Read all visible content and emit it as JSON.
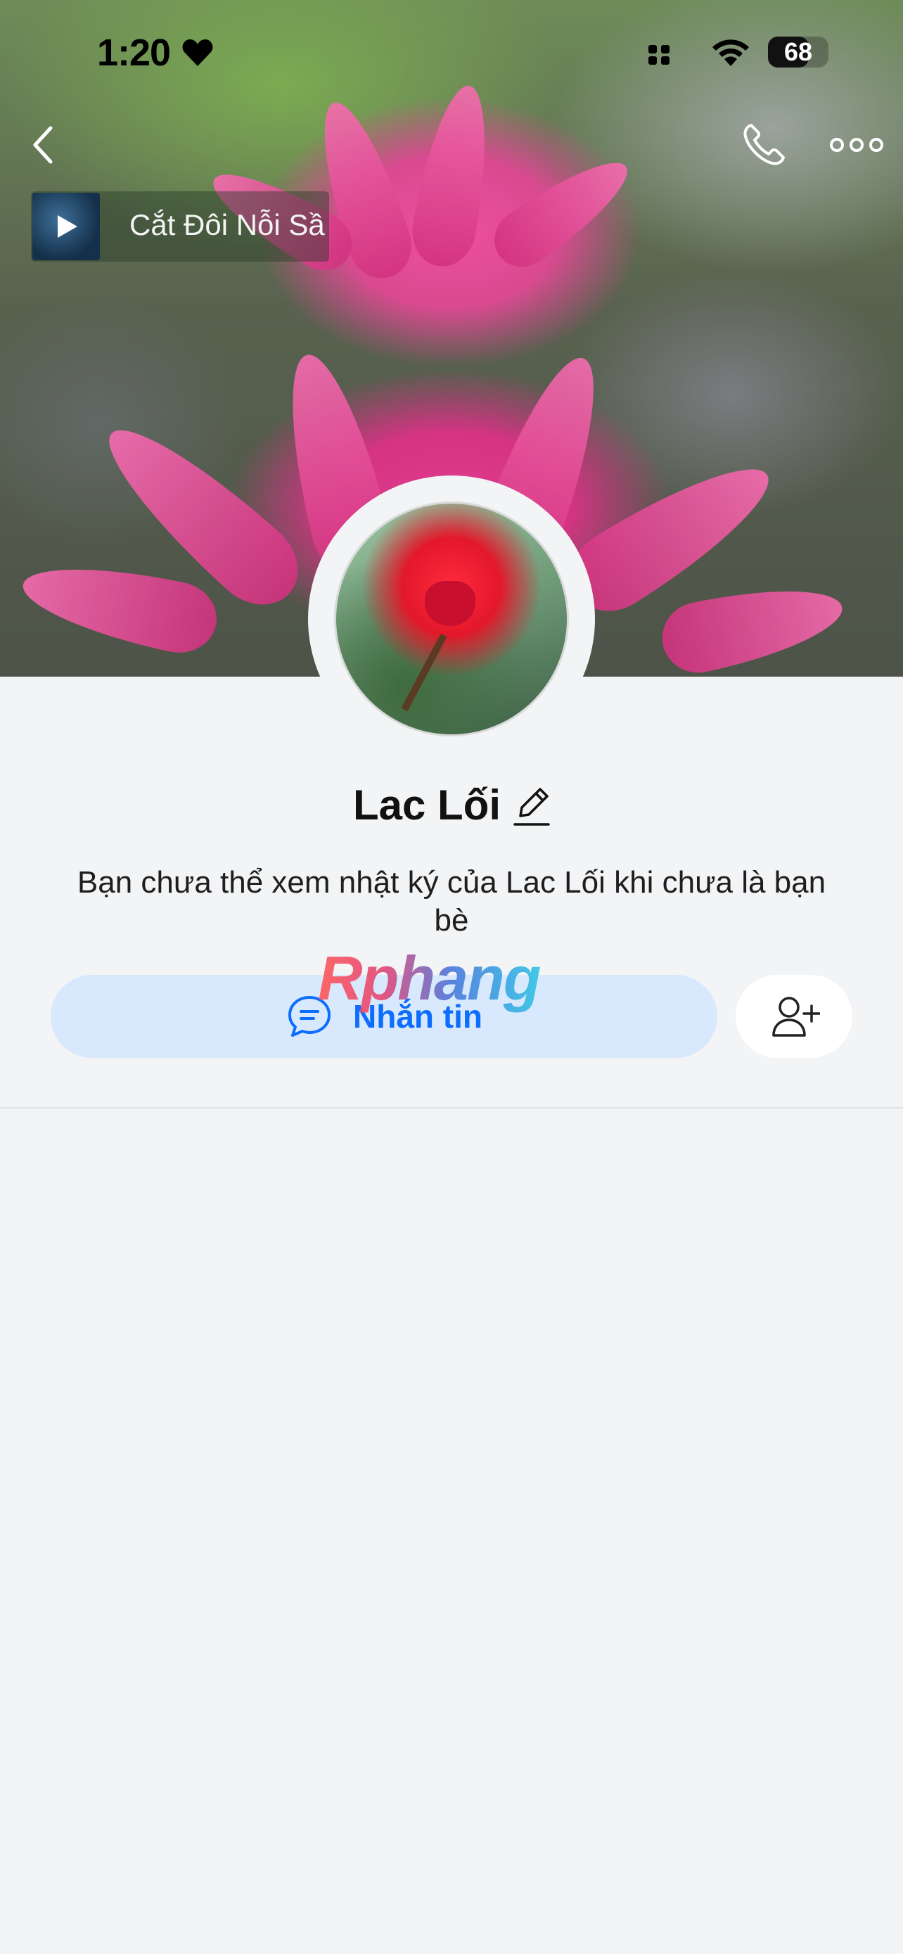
{
  "status_bar": {
    "time": "1:20",
    "battery": "68",
    "battery_level": 0.68
  },
  "header": {
    "icons": [
      "back-icon",
      "phone-icon",
      "more-icon"
    ]
  },
  "music": {
    "title": "Cắt Đôi Nỗi Sầ",
    "icon": "play-icon"
  },
  "profile": {
    "name": "Lac Lối",
    "info": "Bạn chưa thể xem nhật ký của Lac Lối khi chưa là bạn bè"
  },
  "watermark": "Rphang",
  "actions": {
    "message_label": "Nhắn tin",
    "message_icon": "chat-icon",
    "add_friend_icon": "add-friend-icon"
  },
  "colors": {
    "accent": "#0d6efd",
    "message_button_bg": "#d8e8fd",
    "page_bg": "#f3f4f6"
  }
}
